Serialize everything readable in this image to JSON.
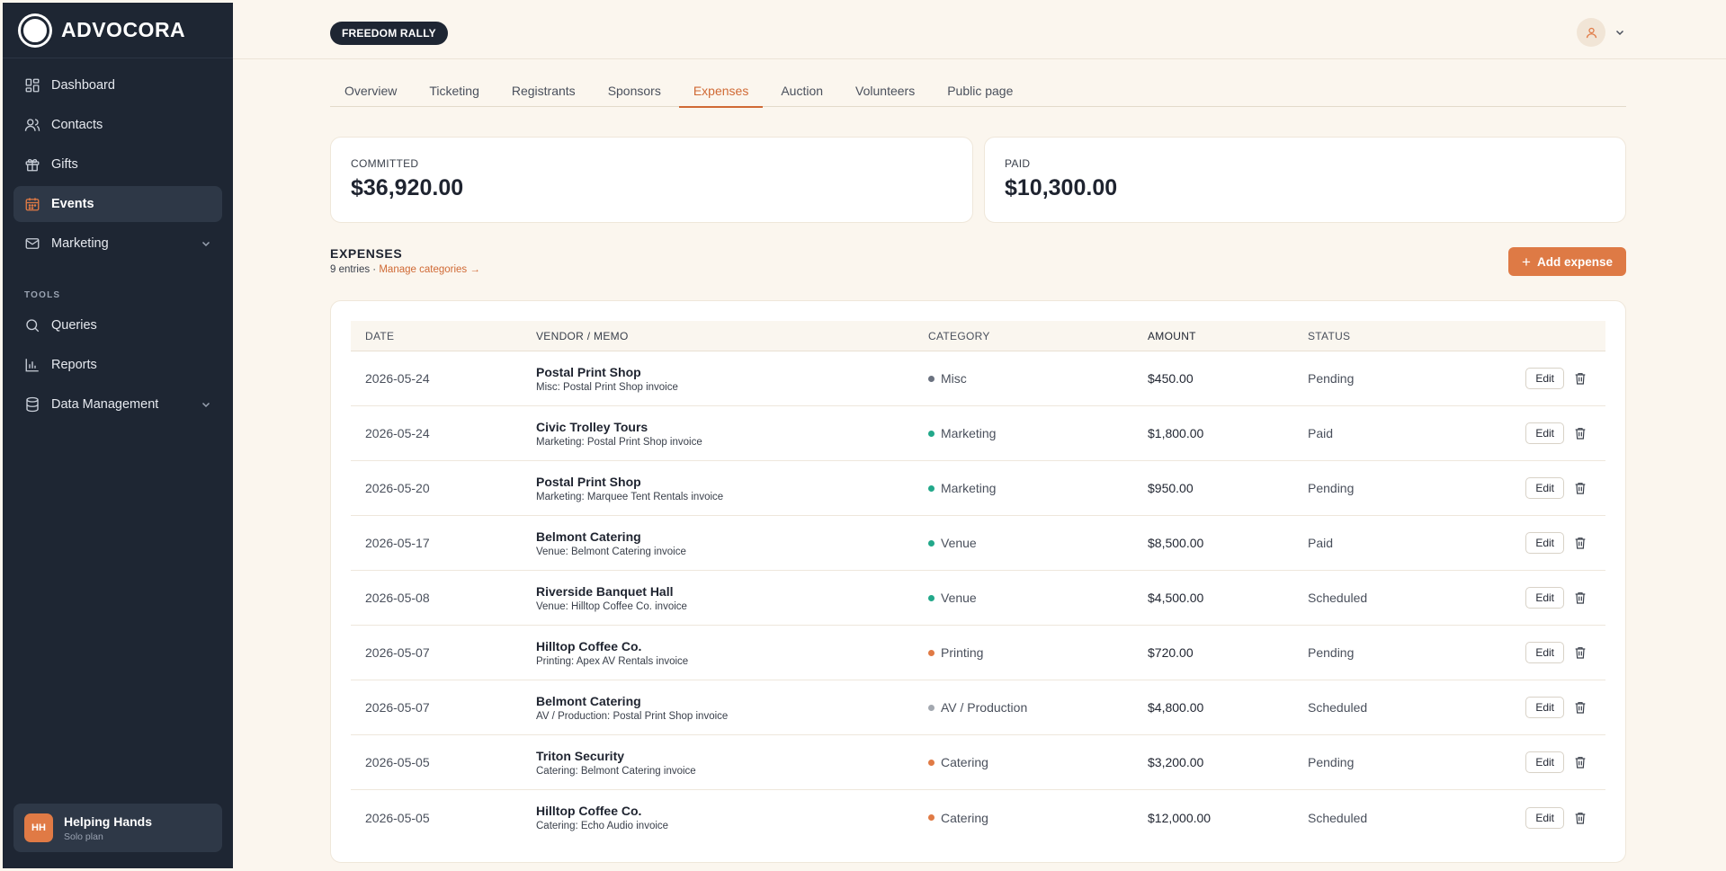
{
  "app": {
    "name": "ADVOCORA"
  },
  "sidebar": {
    "items": [
      {
        "label": "Dashboard",
        "icon": "grid-icon"
      },
      {
        "label": "Contacts",
        "icon": "users-icon"
      },
      {
        "label": "Gifts",
        "icon": "gift-icon"
      },
      {
        "label": "Events",
        "icon": "calendar-icon",
        "active": true
      },
      {
        "label": "Marketing",
        "icon": "mail-icon",
        "expandable": true
      }
    ],
    "tools_label": "TOOLS",
    "tools": [
      {
        "label": "Queries",
        "icon": "search-icon"
      },
      {
        "label": "Reports",
        "icon": "bar-chart-icon"
      },
      {
        "label": "Data Management",
        "icon": "database-icon",
        "expandable": true
      }
    ],
    "workspace": {
      "initials": "HH",
      "name": "Helping Hands",
      "plan": "Solo plan"
    }
  },
  "header": {
    "event_badge": "FREEDOM RALLY"
  },
  "tabs": [
    {
      "label": "Overview"
    },
    {
      "label": "Ticketing"
    },
    {
      "label": "Registrants"
    },
    {
      "label": "Sponsors"
    },
    {
      "label": "Expenses",
      "active": true
    },
    {
      "label": "Auction"
    },
    {
      "label": "Volunteers"
    },
    {
      "label": "Public page"
    }
  ],
  "stats": {
    "committed": {
      "label": "COMMITTED",
      "value": "$36,920.00"
    },
    "paid": {
      "label": "PAID",
      "value": "$10,300.00"
    }
  },
  "expenses": {
    "title": "EXPENSES",
    "entries": "9 entries",
    "separator": " · ",
    "manage_link": "Manage categories →",
    "add_label": "Add expense",
    "columns": {
      "date": "DATE",
      "vendor": "VENDOR / MEMO",
      "category": "CATEGORY",
      "amount": "AMOUNT",
      "status": "STATUS"
    },
    "edit_label": "Edit",
    "category_colors": {
      "Misc": "#6B7280",
      "Marketing": "#22A88A",
      "Venue": "#22A88A",
      "Printing": "#E07A45",
      "AV / Production": "#A3A8B0",
      "Catering": "#E07A45"
    },
    "rows": [
      {
        "date": "2026-05-24",
        "vendor": "Postal Print Shop",
        "memo": "Misc: Postal Print Shop invoice",
        "category": "Misc",
        "amount": "$450.00",
        "status": "Pending"
      },
      {
        "date": "2026-05-24",
        "vendor": "Civic Trolley Tours",
        "memo": "Marketing: Postal Print Shop invoice",
        "category": "Marketing",
        "amount": "$1,800.00",
        "status": "Paid"
      },
      {
        "date": "2026-05-20",
        "vendor": "Postal Print Shop",
        "memo": "Marketing: Marquee Tent Rentals invoice",
        "category": "Marketing",
        "amount": "$950.00",
        "status": "Pending"
      },
      {
        "date": "2026-05-17",
        "vendor": "Belmont Catering",
        "memo": "Venue: Belmont Catering invoice",
        "category": "Venue",
        "amount": "$8,500.00",
        "status": "Paid"
      },
      {
        "date": "2026-05-08",
        "vendor": "Riverside Banquet Hall",
        "memo": "Venue: Hilltop Coffee Co. invoice",
        "category": "Venue",
        "amount": "$4,500.00",
        "status": "Scheduled"
      },
      {
        "date": "2026-05-07",
        "vendor": "Hilltop Coffee Co.",
        "memo": "Printing: Apex AV Rentals invoice",
        "category": "Printing",
        "amount": "$720.00",
        "status": "Pending"
      },
      {
        "date": "2026-05-07",
        "vendor": "Belmont Catering",
        "memo": "AV / Production: Postal Print Shop invoice",
        "category": "AV / Production",
        "amount": "$4,800.00",
        "status": "Scheduled"
      },
      {
        "date": "2026-05-05",
        "vendor": "Triton Security",
        "memo": "Catering: Belmont Catering invoice",
        "category": "Catering",
        "amount": "$3,200.00",
        "status": "Pending"
      },
      {
        "date": "2026-05-05",
        "vendor": "Hilltop Coffee Co.",
        "memo": "Catering: Echo Audio invoice",
        "category": "Catering",
        "amount": "$12,000.00",
        "status": "Scheduled"
      }
    ]
  }
}
